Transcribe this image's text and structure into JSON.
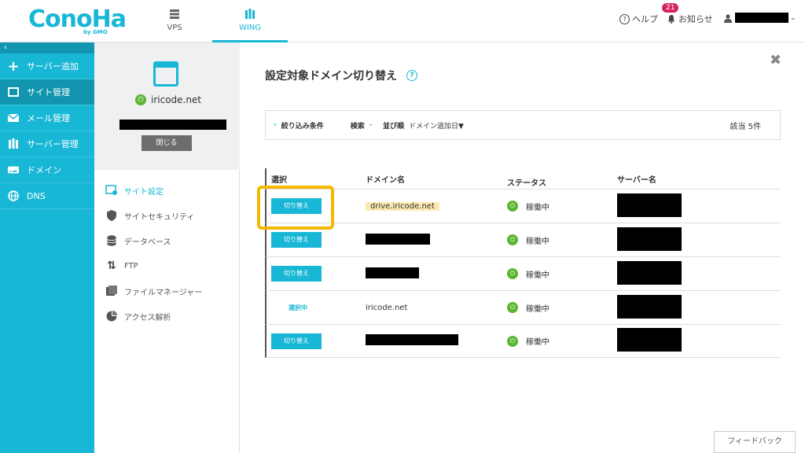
{
  "header": {
    "logo": "ConoHa",
    "logo_sub": "by GMO",
    "tabs": [
      {
        "label": "VPS"
      },
      {
        "label": "WING"
      }
    ],
    "help": "ヘルプ",
    "notice": "お知らせ",
    "notice_count": "21"
  },
  "sidebar": {
    "items": [
      {
        "label": "サーバー追加"
      },
      {
        "label": "サイト管理"
      },
      {
        "label": "メール管理"
      },
      {
        "label": "サーバー管理"
      },
      {
        "label": "ドメイン"
      },
      {
        "label": "DNS"
      }
    ]
  },
  "left_panel": {
    "site_name": "iricode.net",
    "close_label": "閉じる",
    "menu": [
      {
        "label": "サイト設定"
      },
      {
        "label": "サイトセキュリティ"
      },
      {
        "label": "データベース"
      },
      {
        "label": "FTP"
      },
      {
        "label": "ファイルマネージャー"
      },
      {
        "label": "アクセス解析"
      }
    ]
  },
  "main": {
    "title": "設定対象ドメイン切り替え",
    "filter": {
      "label": "絞り込み条件",
      "search_label": "検索",
      "search_value": "-",
      "sort_label": "並び順",
      "sort_value": "ドメイン追加日▼",
      "count": "該当 5件"
    },
    "table": {
      "headers": [
        "選択",
        "ドメイン名",
        "ステータス",
        "サーバー名"
      ],
      "rows": [
        {
          "action": "切り替え",
          "domain": "drive.iricode.net",
          "status": "稼働中"
        },
        {
          "action": "切り替え",
          "domain": "",
          "status": "稼働中"
        },
        {
          "action": "切り替え",
          "domain": "",
          "status": "稼働中"
        },
        {
          "action": "選択中",
          "domain": "iricode.net",
          "status": "稼働中"
        },
        {
          "action": "切り替え",
          "domain": "",
          "status": "稼働中"
        }
      ]
    },
    "feedback": "フィードバック"
  },
  "colors": {
    "accent": "#19b7d6",
    "highlight": "#f5b800",
    "status_ok": "#5cb531"
  }
}
